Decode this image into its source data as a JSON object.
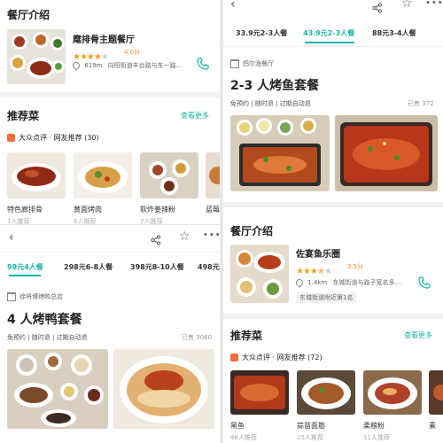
{
  "top_left": {
    "section_title": "餐厅介绍",
    "restaurant": {
      "name": "麾排骨主题餐厅",
      "rating": 4.0,
      "rating_text": "4.0分",
      "distance": "619m",
      "address": "向阳街道丰台路与东一路…"
    },
    "recommend_title": "推荐菜",
    "more_label": "查看更多",
    "source_label": "大众点评 · 网友推荐 (30)",
    "dishes": [
      {
        "name": "特色廊排骨",
        "likes": "1人推荐"
      },
      {
        "name": "黄面烤肉",
        "likes": "6人推荐"
      },
      {
        "name": "软炸姜辣粉",
        "likes": "7人推荐"
      },
      {
        "name": "蓝莓"
      }
    ]
  },
  "bottom_left": {
    "tabs": [
      {
        "label": "98元4人餐",
        "active": true
      },
      {
        "label": "298元6-8人餐",
        "active": false
      },
      {
        "label": "398元8-10人餐",
        "active": false
      },
      {
        "label": "498元1",
        "active": false
      }
    ],
    "store_name": "徐将博烤鸭总店",
    "package_title": "4 人烤鸭套餐",
    "tags": "免预约 | 随时退 | 过期自动退",
    "sold": "已售 3060"
  },
  "right": {
    "tabs": [
      {
        "label": "33.9元2-3人餐",
        "active": false
      },
      {
        "label": "43.9元2-3人餐",
        "active": true
      },
      {
        "label": "88元3-4人餐",
        "active": false
      }
    ],
    "store_name": "鸽尔渔餐厅",
    "package_title": "2-3 人烤鱼套餐",
    "tags": "免预约 | 随时退 | 过期自动退",
    "sold": "已售 372",
    "intro_title": "餐厅介绍",
    "restaurant": {
      "name": "佐宴鱼乐圈",
      "rating": 3.5,
      "rating_text": "3.5分",
      "distance": "1.4km",
      "address": "东城街道与路子宽名多…",
      "tag": "东城街道附近第1名"
    },
    "recommend_title": "推荐菜",
    "more_label": "查看更多",
    "source_label": "大众点评 · 网友推荐 (72)",
    "dishes": [
      {
        "name": "黑鱼",
        "likes": "46人推荐"
      },
      {
        "name": "蒜苗面筋",
        "likes": "25人推荐"
      },
      {
        "name": "柔粮粉",
        "likes": "11人推荐"
      },
      {
        "name": "素"
      }
    ]
  },
  "colors": {
    "accent": "#18b6a0",
    "star": "#f0a020",
    "dianping": "#f26b3a"
  }
}
